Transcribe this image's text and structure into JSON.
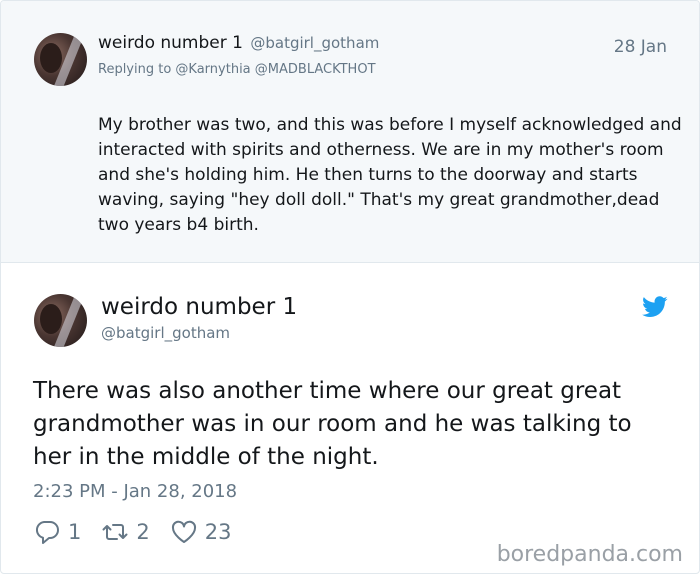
{
  "reply_tweet": {
    "display_name": "weirdo number 1",
    "handle": "@batgirl_gotham",
    "date": "28 Jan",
    "replying_to": "Replying to @Karnythia @MADBLACKTHOT",
    "text": "My brother was two, and this was before I myself acknowledged and interacted with spirits and otherness. We are in my mother's room and she's holding him. He then turns to the doorway and starts waving, saying \"hey doll doll.\" That's my great grandmother,dead two years b4 birth."
  },
  "main_tweet": {
    "display_name": "weirdo number 1",
    "handle": "@batgirl_gotham",
    "text": "There was also another time where our great great grandmother was in our room and he was talking to her in the middle of the night.",
    "timestamp": "2:23 PM - Jan 28, 2018",
    "reply_count": "1",
    "retweet_count": "2",
    "like_count": "23"
  },
  "icons": {
    "logo": "twitter-bird-icon",
    "reply": "reply-bubble-icon",
    "retweet": "retweet-icon",
    "like": "heart-icon"
  },
  "colors": {
    "twitter_blue": "#1da1f2",
    "secondary_text": "#657786",
    "reply_background": "#f5f8fa"
  },
  "watermark": "boredpanda.com"
}
